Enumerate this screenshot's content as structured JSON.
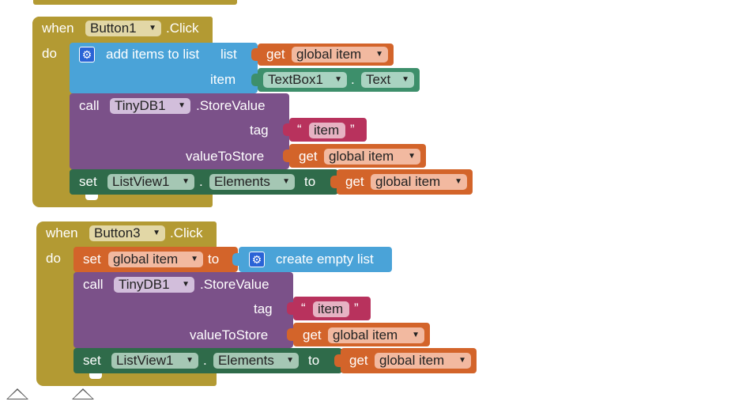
{
  "blocks": {
    "event1": {
      "when_label": "when",
      "component": "Button1",
      "event": ".Click",
      "do_label": "do",
      "add_items": {
        "label": "add items to list",
        "list_label": "list",
        "item_label": "item"
      },
      "get_global_item": {
        "get": "get",
        "var": "global item"
      },
      "textbox": {
        "component": "TextBox1",
        "dot": ".",
        "property": "Text"
      },
      "store": {
        "call": "call",
        "component": "TinyDB1",
        "method": ".StoreValue",
        "tag_label": "tag",
        "value_label": "valueToStore"
      },
      "tag_string": {
        "open_quote": "“",
        "value": "item",
        "close_quote": "”"
      },
      "set_elements": {
        "set": "set",
        "component": "ListView1",
        "dot": ".",
        "property": "Elements",
        "to": "to"
      }
    },
    "event2": {
      "when_label": "when",
      "component": "Button3",
      "event": ".Click",
      "do_label": "do",
      "set_global": {
        "set": "set",
        "var": "global item",
        "to": "to"
      },
      "create_list": "create empty list",
      "get_global_item": {
        "get": "get",
        "var": "global item"
      },
      "store": {
        "call": "call",
        "component": "TinyDB1",
        "method": ".StoreValue",
        "tag_label": "tag",
        "value_label": "valueToStore"
      },
      "tag_string": {
        "open_quote": "“",
        "value": "item",
        "close_quote": "”"
      },
      "set_elements": {
        "set": "set",
        "component": "ListView1",
        "dot": ".",
        "property": "Elements",
        "to": "to"
      }
    }
  },
  "icons": {
    "gear": "gear-icon",
    "dropdown": "▼",
    "workspace_control": "triangle-up-icon"
  },
  "colors": {
    "event": "#b39a33",
    "procedure": "#7b5189",
    "list": "#4aa3d8",
    "variable": "#d3642a",
    "component_getter": "#3d8f6b",
    "component_setter": "#2f6b4a",
    "text": "#b8325d"
  }
}
